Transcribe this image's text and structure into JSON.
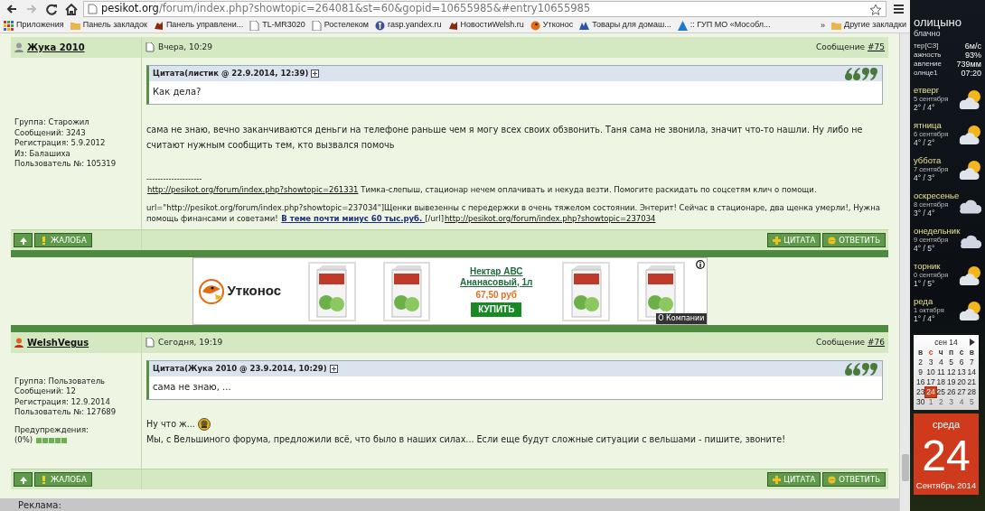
{
  "browser": {
    "url_host": "pesikot.org",
    "url_path": "/forum/index.php?showtopic=264081&st=60&gopid=10655985&#entry10655985",
    "forward_disabled": true,
    "bookmarks": [
      {
        "label": "Приложения",
        "kind": "apps"
      },
      {
        "label": "Панель закладок",
        "kind": "folder"
      },
      {
        "label": "Панель управлени...",
        "kind": "site"
      },
      {
        "label": "TL-MR3020",
        "kind": "page"
      },
      {
        "label": "Ростелеком",
        "kind": "page"
      },
      {
        "label": "rasp.yandex.ru",
        "kind": "yandex"
      },
      {
        "label": "НовостиWelsh.ru",
        "kind": "site"
      },
      {
        "label": "Утконос",
        "kind": "duck"
      },
      {
        "label": "Товары для домаш...",
        "kind": "shop"
      },
      {
        "label": ":: ГУП МО «Мособл...",
        "kind": "triangle"
      }
    ],
    "overflow": "»",
    "other_bookmarks": "Другие закладки"
  },
  "posts": [
    {
      "author": "Жука 2010",
      "online": false,
      "date": "Вчера, 10:29",
      "number_label": "Сообщение",
      "number": "#75",
      "profile": [
        "Группа: Старожил",
        "Сообщений: 3243",
        "Регистрация: 5.9.2012",
        "Из: Балашиха",
        "Пользователь №: 105319"
      ],
      "quote": {
        "header": "Цитата(листик @ 22.9.2014, 12:39)",
        "text": "Как дела?"
      },
      "body": [
        [
          {
            "kind": "text",
            "text": "сама не знаю, вечно заканчиваются деньги на телефоне раньше чем я могу всех своих обзвонить. Таня сама не звонила, значит что-то нашли. Ну либо не считают нужным сообщить тем, кто вызвался помочь"
          }
        ]
      ],
      "signature": {
        "rule": "--------------------",
        "lines": [
          [
            {
              "kind": "link",
              "text": "http://pesikot.org/forum/index.php?showtopic=261331"
            },
            {
              "kind": "text",
              "text": " Тимка-слепыш, стационар нечем оплачивать и некуда везти. Помогите раскидать по соцсетям клич о помощи."
            }
          ],
          [
            {
              "kind": "text",
              "text": "url=\"http://pesikot.org/forum/index.php?showtopic=237034\"]Щенки вывезенны с передержки в очень тяжелом состоянии. Энтерит! Сейчас в стационаре, два щенка умерли!, Нужна помощь финансами и советами! "
            },
            {
              "kind": "bold-link",
              "text": "В теме почти минус 60 тыс.руб. "
            },
            {
              "kind": "text",
              "text": "[/url]"
            },
            {
              "kind": "link",
              "text": "http://pesikot.org/forum/index.php?showtopic=237034"
            }
          ]
        ]
      },
      "left_buttons": [
        {
          "kind": "up"
        },
        {
          "kind": "report",
          "label": "ЖАЛОБА"
        }
      ],
      "right_buttons": [
        {
          "kind": "quote",
          "label": "ЦИТАТА"
        },
        {
          "kind": "reply",
          "label": "ОТВЕТИТЬ"
        }
      ]
    },
    {
      "author": "WelshVegus",
      "online": true,
      "date": "Сегодня, 19:19",
      "number_label": "Сообщение",
      "number": "#76",
      "profile": [
        "Группа: Пользователь",
        "Сообщений: 12",
        "Регистрация: 12.9.2014",
        "Пользователь №: 127689"
      ],
      "warnings": {
        "label": "Предупреждения:",
        "value": "(0%)"
      },
      "quote": {
        "header": "Цитата(Жука 2010 @ 23.9.2014, 10:29)",
        "text": "сама не знаю, ..."
      },
      "body": [
        [
          {
            "kind": "text",
            "text": "Ну что ж... "
          },
          {
            "kind": "smiley"
          }
        ],
        [
          {
            "kind": "text",
            "text": "Мы, с Вельшиного форума, предложили всё, что было в наших силах... Если еще будут сложные ситуации с вельшами - пишите, звоните!"
          }
        ]
      ],
      "left_buttons": [
        {
          "kind": "up"
        },
        {
          "kind": "report",
          "label": "ЖАЛОБА"
        }
      ],
      "right_buttons": [
        {
          "kind": "quote",
          "label": "ЦИТАТА"
        },
        {
          "kind": "reply",
          "label": "ОТВЕТИТЬ"
        }
      ]
    }
  ],
  "ad": {
    "logo": "Утконос",
    "items": [
      {
        "kind": "product"
      },
      {
        "kind": "product"
      },
      {
        "kind": "offer",
        "title": "Нектар АВС Ананасовый, 1л",
        "price": "67,50 руб",
        "button": "КУПИТЬ"
      },
      {
        "kind": "product"
      },
      {
        "kind": "product"
      }
    ],
    "about": "О Компании"
  },
  "ad_bar": {
    "label": "Реклама:"
  },
  "weather": {
    "city": "олицыно",
    "condition": "блачно",
    "stats": [
      {
        "label": "тер[СЗ]",
        "value": "6м/с"
      },
      {
        "label": "ажность",
        "value": "93%"
      },
      {
        "label": "авление",
        "value": "739мм"
      },
      {
        "label": "олнце1",
        "value": "07:20"
      }
    ],
    "days": [
      {
        "day": "етверг",
        "date": "5 сентября",
        "temps": "2° / 4°",
        "kind": "sun-cloud"
      },
      {
        "day": "ятница",
        "date": "6 сентября",
        "temps": "4° / 2°",
        "kind": "sun-cloud"
      },
      {
        "day": "уббота",
        "date": "7 сентября",
        "temps": "4° / 3°",
        "kind": "sun-cloud"
      },
      {
        "day": "оскресенье",
        "date": "8 сентября",
        "temps": "3° / 4°",
        "kind": "cloud"
      },
      {
        "day": "онедельник",
        "date": "9 сентября",
        "temps": "4° / 5°",
        "kind": "cloud"
      },
      {
        "day": "торник",
        "date": "0 сентября",
        "temps": "1° / 5°",
        "kind": "sun-cloud"
      },
      {
        "day": "реда",
        "date": "1 октября",
        "temps": "1° / 4°",
        "kind": "sun-cloud"
      }
    ]
  },
  "calendar": {
    "month": "сен 14",
    "weekdays": [
      {
        "label": "в",
        "today": false
      },
      {
        "label": "с",
        "today": true
      },
      {
        "label": "ч",
        "today": false
      },
      {
        "label": "п",
        "today": false
      },
      {
        "label": "с",
        "today": false
      },
      {
        "label": "в",
        "today": false
      }
    ],
    "weeks": [
      [
        {
          "day": "2",
          "other": false,
          "selected": false
        },
        {
          "day": "3",
          "other": false,
          "selected": false
        },
        {
          "day": "4",
          "other": false,
          "selected": false
        },
        {
          "day": "5",
          "other": false,
          "selected": false
        },
        {
          "day": "6",
          "other": false,
          "selected": false
        },
        {
          "day": "7",
          "other": false,
          "selected": false
        }
      ],
      [
        {
          "day": "9",
          "other": false,
          "selected": false
        },
        {
          "day": "10",
          "other": false,
          "selected": false
        },
        {
          "day": "11",
          "other": false,
          "selected": false
        },
        {
          "day": "12",
          "other": false,
          "selected": false
        },
        {
          "day": "13",
          "other": false,
          "selected": false
        },
        {
          "day": "14",
          "other": false,
          "selected": false
        }
      ],
      [
        {
          "day": "16",
          "other": false,
          "selected": false
        },
        {
          "day": "17",
          "other": false,
          "selected": false
        },
        {
          "day": "18",
          "other": false,
          "selected": false
        },
        {
          "day": "19",
          "other": false,
          "selected": false
        },
        {
          "day": "20",
          "other": false,
          "selected": false
        },
        {
          "day": "21",
          "other": false,
          "selected": false
        }
      ],
      [
        {
          "day": "23",
          "other": false,
          "selected": false
        },
        {
          "day": "24",
          "other": false,
          "selected": true
        },
        {
          "day": "25",
          "other": false,
          "selected": false
        },
        {
          "day": "26",
          "other": false,
          "selected": false
        },
        {
          "day": "27",
          "other": false,
          "selected": false
        },
        {
          "day": "28",
          "other": false,
          "selected": false
        }
      ],
      [
        {
          "day": "30",
          "other": false,
          "selected": false
        },
        {
          "day": "1",
          "other": true,
          "selected": false
        },
        {
          "day": "2",
          "other": true,
          "selected": false
        },
        {
          "day": "3",
          "other": true,
          "selected": false
        },
        {
          "day": "4",
          "other": true,
          "selected": false
        },
        {
          "day": "5",
          "other": true,
          "selected": false
        }
      ]
    ],
    "weekday": "среда",
    "day": "24",
    "month_year": "Сентябрь 2014"
  }
}
